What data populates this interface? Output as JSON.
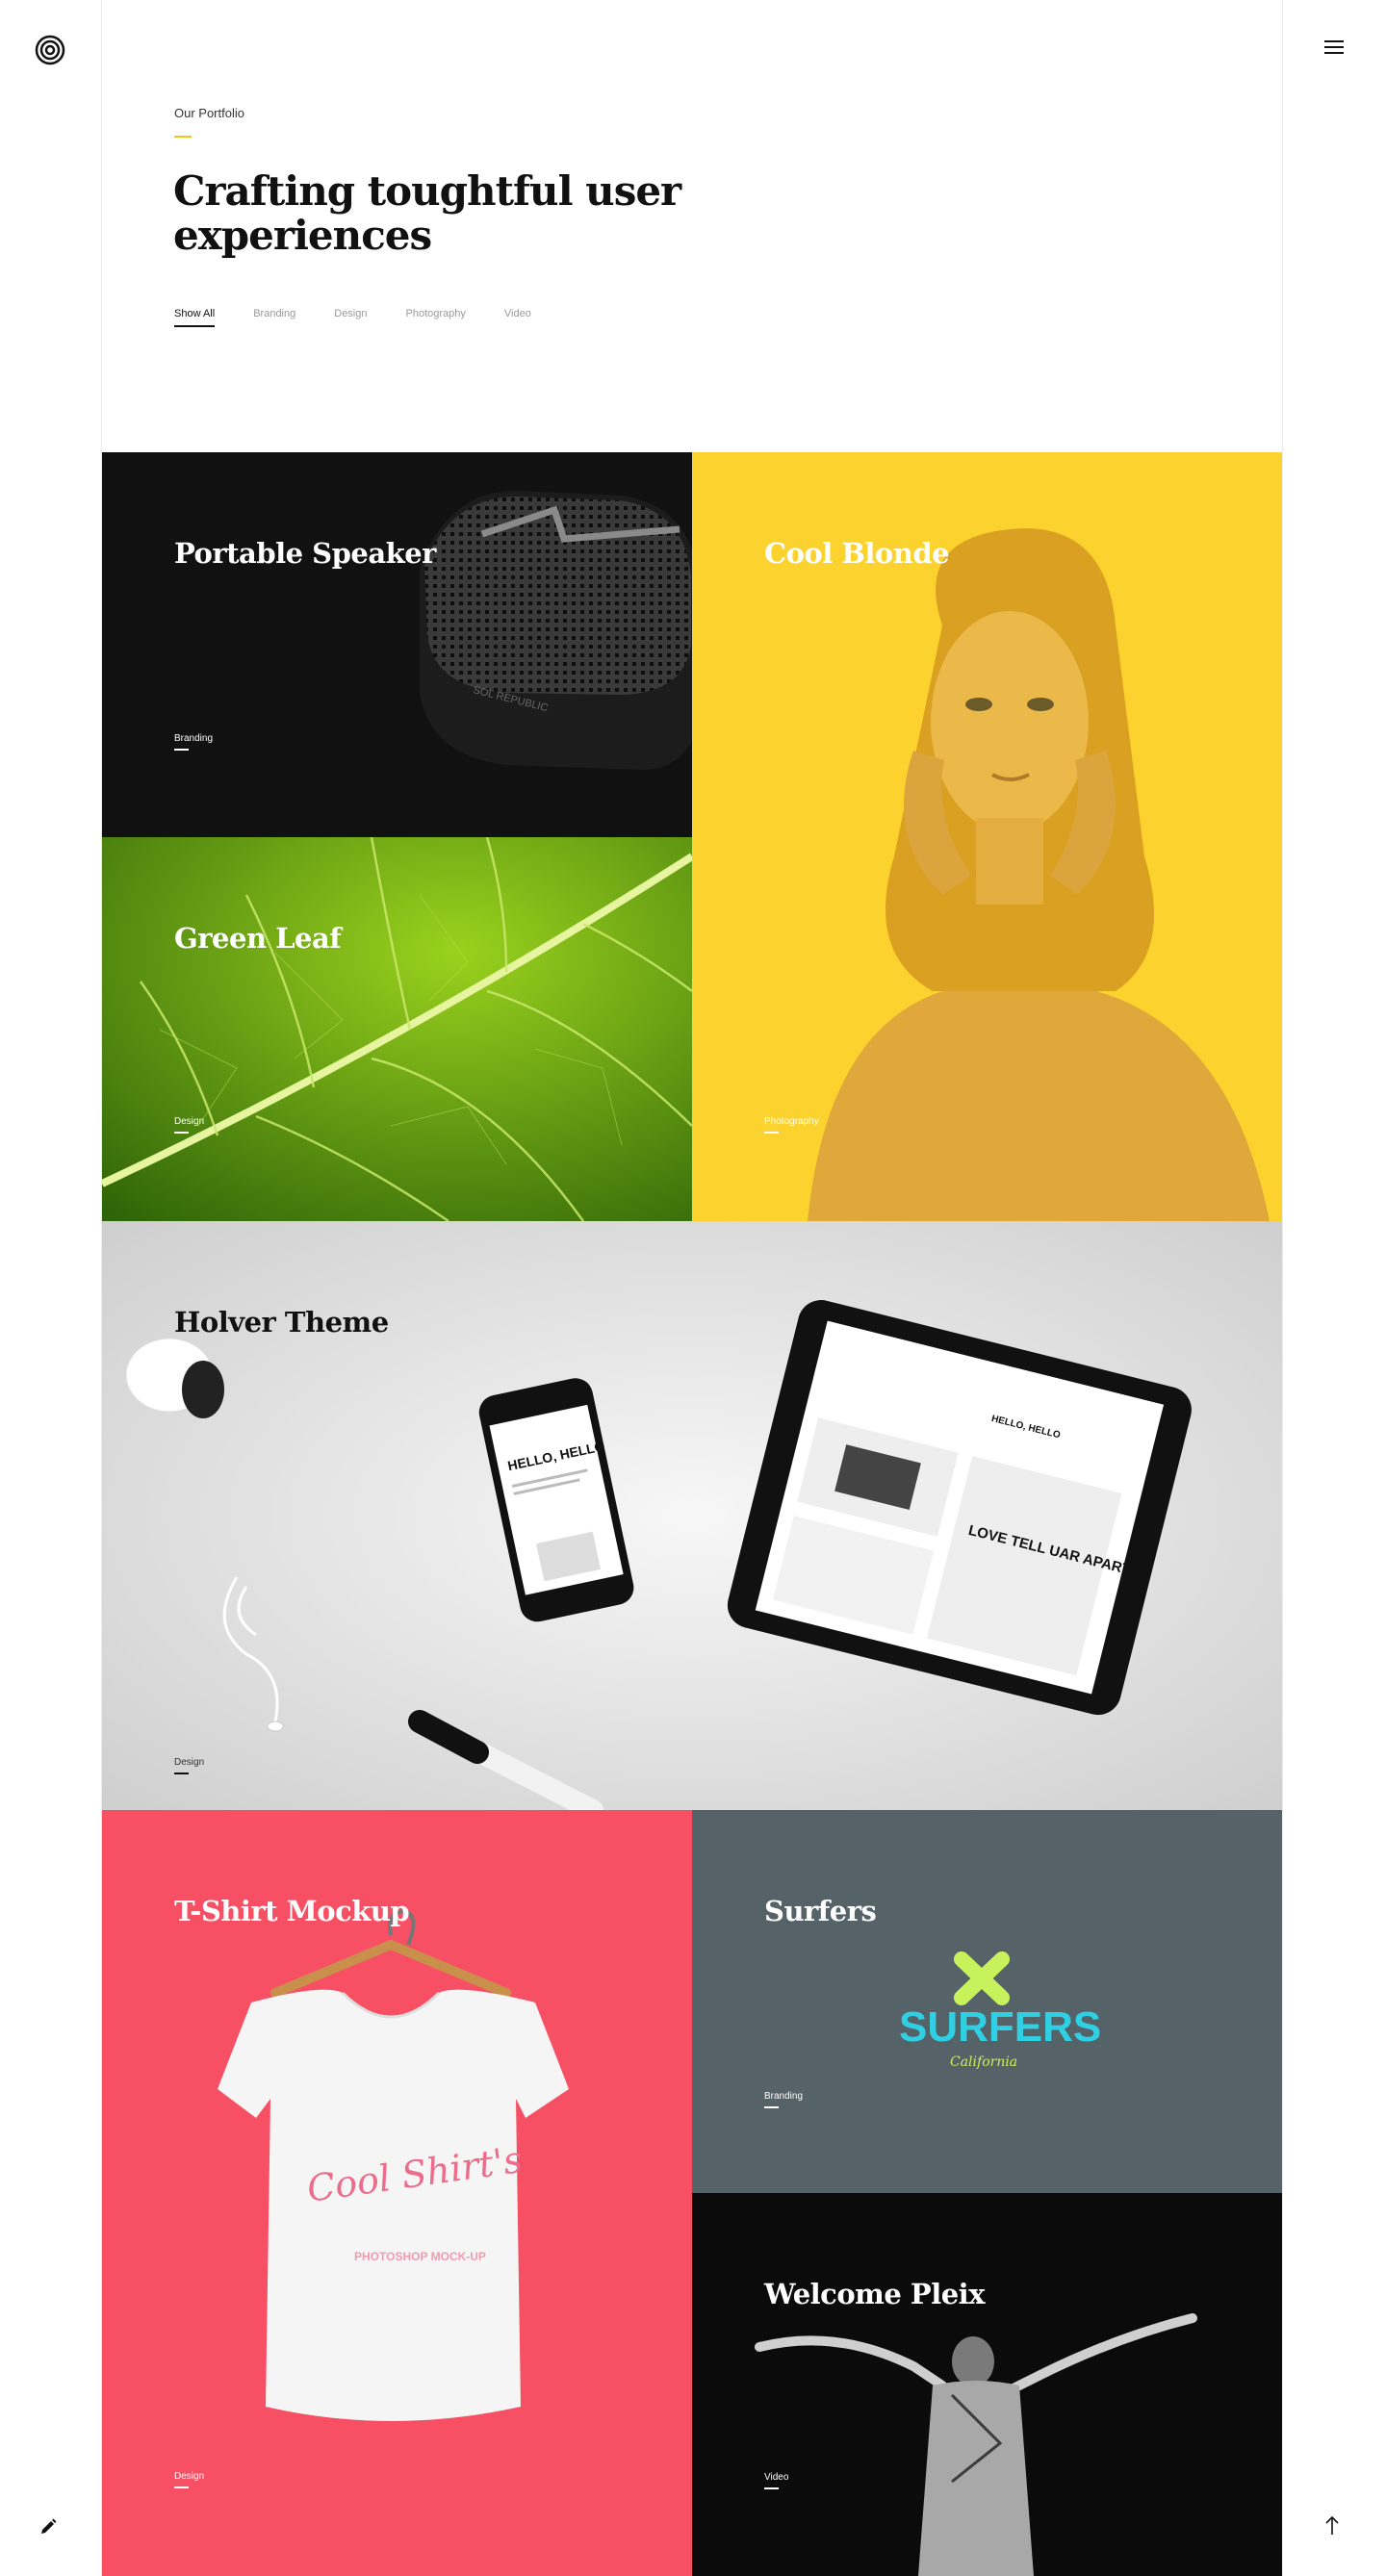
{
  "header": {
    "eyebrow": "Our Portfolio",
    "title": "Crafting toughtful user experiences",
    "filters": [
      "Show All",
      "Branding",
      "Design",
      "Photography",
      "Video"
    ],
    "active_filter": "Show All"
  },
  "nav": {
    "logo_icon": "concentric-circles-logo-icon",
    "menu_icon": "hamburger-menu-icon",
    "edit_icon": "pencil-icon",
    "scroll_top_icon": "arrow-up-icon"
  },
  "projects": [
    {
      "title": "Portable Speaker",
      "category": "Branding",
      "color": "#111111"
    },
    {
      "title": "Cool Blonde",
      "category": "Photography",
      "color": "#fcd22e"
    },
    {
      "title": "Green Leaf",
      "category": "Design",
      "color": "#5a9a10"
    },
    {
      "title": "Holver Theme",
      "category": "Design",
      "color": "#dcdcdc"
    },
    {
      "title": "T-Shirt Mockup",
      "category": "Design",
      "color": "#f74f63"
    },
    {
      "title": "Surfers",
      "category": "Branding",
      "color": "#556268"
    },
    {
      "title": "Welcome Pleix",
      "category": "Video",
      "color": "#0b0b0b"
    }
  ],
  "artwork_text": {
    "speaker_brand": "SOL REPUBLIC",
    "phone_heading": "HELLO, HELLO",
    "tablet_heading": "HELLO, HELLO",
    "poster_text": "LOVE TELL UAR APART",
    "shirt_script": "Cool Shirt's",
    "shirt_sub": "PHOTOSHOP MOCK-UP",
    "surfers_logo": "SURFERS",
    "surfers_sub": "California"
  },
  "colors": {
    "accent": "#f5c518",
    "text": "#111111",
    "muted": "#999999"
  }
}
